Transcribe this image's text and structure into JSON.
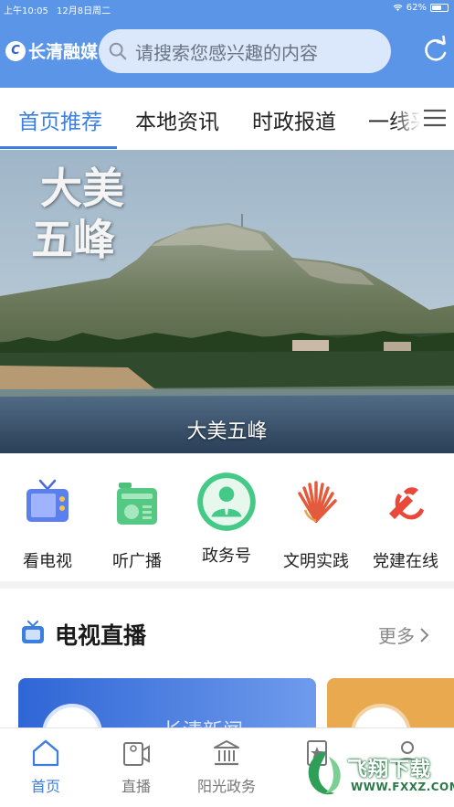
{
  "status_bar": {
    "time": "上午10:05",
    "date": "12月8日周二",
    "battery": "62%",
    "battery_level": 0.62
  },
  "header": {
    "app_name": "长清融媒",
    "search_placeholder": "请搜索您感兴趣的内容"
  },
  "tabs": [
    {
      "label": "首页推荐",
      "active": true
    },
    {
      "label": "本地资讯",
      "active": false
    },
    {
      "label": "时政报道",
      "active": false
    },
    {
      "label": "一线采",
      "active": false
    }
  ],
  "banner": {
    "title_line1": "大美",
    "title_line2": "五峰",
    "caption": "大美五峰"
  },
  "entries": [
    {
      "label": "看电视",
      "icon": "tv-icon"
    },
    {
      "label": "听广播",
      "icon": "radio-icon"
    },
    {
      "label": "政务号",
      "icon": "official-account-icon"
    },
    {
      "label": "文明实践",
      "icon": "civilization-practice-icon"
    },
    {
      "label": "党建在线",
      "icon": "party-building-icon"
    }
  ],
  "section": {
    "title": "电视直播",
    "more": "更多",
    "card_title": "长清新闻"
  },
  "bottom_nav": [
    {
      "label": "首页",
      "icon": "home-icon",
      "active": true
    },
    {
      "label": "直播",
      "icon": "live-icon",
      "active": false
    },
    {
      "label": "阳光政务",
      "icon": "government-icon",
      "active": false
    },
    {
      "label": "",
      "icon": "star-icon",
      "active": false
    },
    {
      "label": "",
      "icon": "user-icon",
      "active": false
    }
  ],
  "watermark": {
    "text": "飞翔下载",
    "url": "WWW.FXXZ.COM"
  },
  "colors": {
    "header": "#5b95e8",
    "accent": "#3d7fe0"
  }
}
